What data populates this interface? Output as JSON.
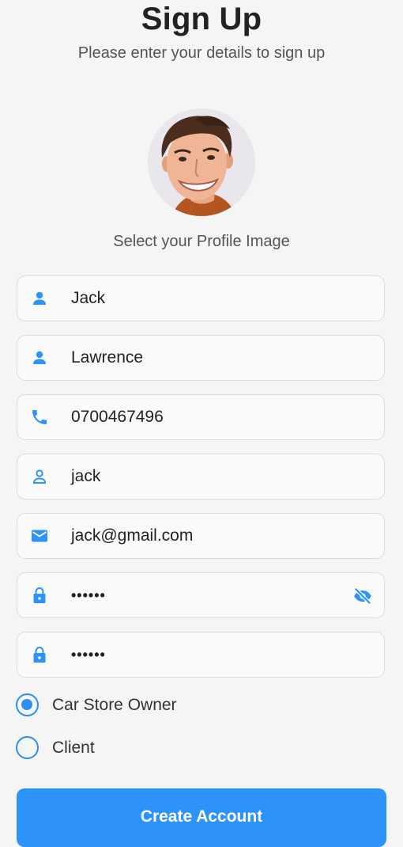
{
  "header": {
    "title": "Sign Up",
    "subtitle": "Please enter your details to sign up"
  },
  "profile": {
    "caption": "Select your Profile Image"
  },
  "form": {
    "first_name": {
      "value": "Jack",
      "icon": "person-icon"
    },
    "last_name": {
      "value": "Lawrence",
      "icon": "person-icon"
    },
    "phone": {
      "value": "0700467496",
      "icon": "phone-icon"
    },
    "username": {
      "value": "jack",
      "icon": "person-outline-icon"
    },
    "email": {
      "value": "jack@gmail.com",
      "icon": "email-icon"
    },
    "password": {
      "value": "••••••",
      "icon": "lock-icon",
      "toggle_icon": "eye-off-icon"
    },
    "confirm_password": {
      "value": "••••••",
      "icon": "lock-icon"
    }
  },
  "role": {
    "options": [
      {
        "label": "Car Store Owner",
        "selected": true
      },
      {
        "label": "Client",
        "selected": false
      }
    ]
  },
  "actions": {
    "create_label": "Create Account"
  },
  "colors": {
    "accent": "#2e93f8",
    "background": "#f5f5f5"
  }
}
